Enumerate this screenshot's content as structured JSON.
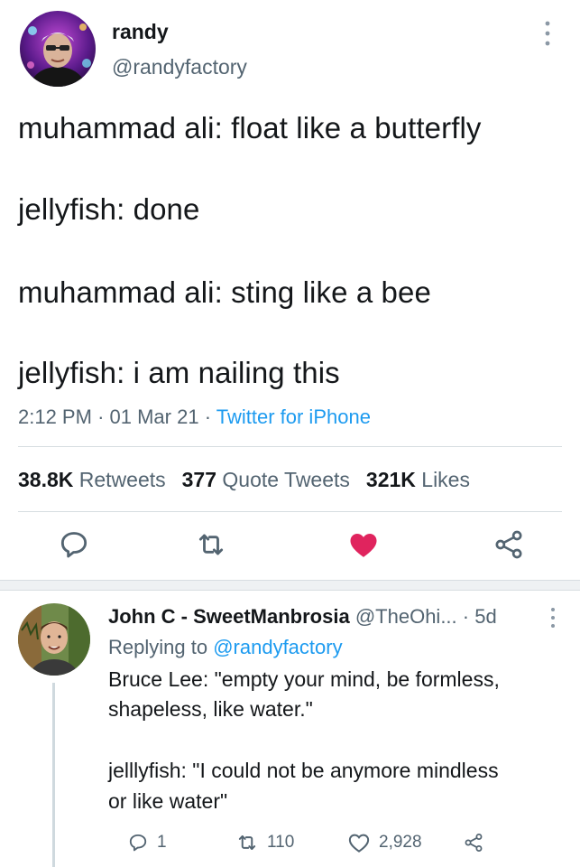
{
  "main_tweet": {
    "display_name": "randy",
    "handle": "@randyfactory",
    "lines": [
      "muhammad ali: float like a butterfly",
      "jellyfish: done",
      "muhammad ali: sting like a bee",
      "jellyfish: i am nailing this"
    ],
    "time": "2:12 PM",
    "date": "01 Mar 21",
    "separator": "·",
    "source": "Twitter for iPhone",
    "stats": {
      "retweets_count": "38.8K",
      "retweets_label": "Retweets",
      "quotes_count": "377",
      "quotes_label": "Quote Tweets",
      "likes_count": "321K",
      "likes_label": "Likes"
    },
    "actions": [
      "reply-icon",
      "retweet-icon",
      "like-icon-filled",
      "share-icon"
    ],
    "liked_color": "#e0245e"
  },
  "reply": {
    "display_name": "John C - SweetManbrosia",
    "handle": "@TheOhi...",
    "age": "· 5d",
    "replying_prefix": "Replying to",
    "replying_to": "@randyfactory",
    "lines": [
      "Bruce Lee: \"empty your mind, be formless,",
      "shapeless, like water.\"",
      "jelllyfish: \"I could not  be anymore mindless",
      "or like water\""
    ],
    "counts": {
      "replies": "1",
      "retweets": "110",
      "likes": "2,928"
    }
  },
  "colors": {
    "text": "#14171a",
    "secondary": "#536471",
    "link": "#1d9bf0",
    "divider": "#d7dde1"
  }
}
